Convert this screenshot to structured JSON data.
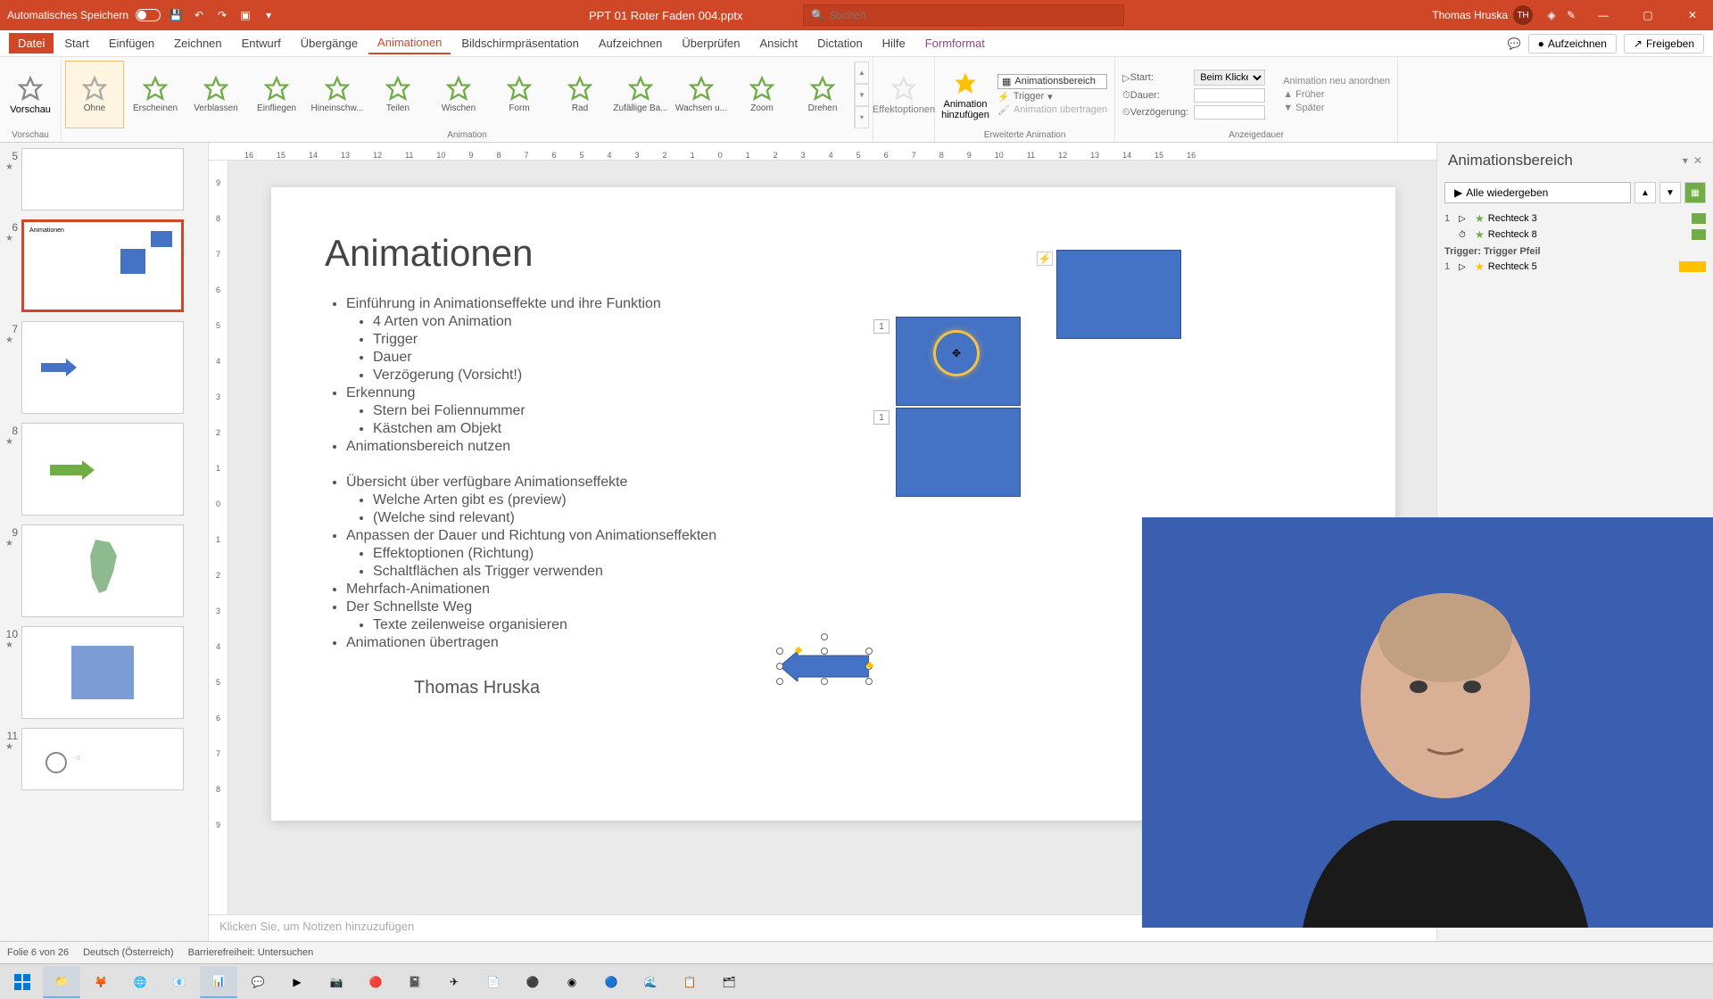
{
  "titlebar": {
    "autosave": "Automatisches Speichern",
    "filename": "PPT 01 Roter Faden 004.pptx",
    "search_placeholder": "Suchen",
    "user_name": "Thomas Hruska",
    "user_initials": "TH"
  },
  "menu": {
    "tabs": [
      "Datei",
      "Start",
      "Einfügen",
      "Zeichnen",
      "Entwurf",
      "Übergänge",
      "Animationen",
      "Bildschirmpräsentation",
      "Aufzeichnen",
      "Überprüfen",
      "Ansicht",
      "Dictation",
      "Hilfe",
      "Formformat"
    ],
    "active": "Animationen",
    "record": "Aufzeichnen",
    "share": "Freigeben"
  },
  "ribbon": {
    "preview": "Vorschau",
    "preview_group": "Vorschau",
    "gallery": [
      "Ohne",
      "Erscheinen",
      "Verblassen",
      "Einfliegen",
      "Hineinschw...",
      "Teilen",
      "Wischen",
      "Form",
      "Rad",
      "Zufällige Ba...",
      "Wachsen u...",
      "Zoom",
      "Drehen"
    ],
    "gallery_group": "Animation",
    "effect_options": "Effektoptionen",
    "add_anim": "Animation hinzufügen",
    "anims_pane": "Animationsbereich",
    "trigger": "Trigger",
    "copy_anim": "Animation übertragen",
    "adv_group": "Erweiterte Animation",
    "start_lbl": "Start:",
    "start_val": "Beim Klicken",
    "duration_lbl": "Dauer:",
    "delay_lbl": "Verzögerung:",
    "reorder": "Animation neu anordnen",
    "earlier": "Früher",
    "later": "Später",
    "timing_group": "Anzeigedauer"
  },
  "ruler_marks": [
    "16",
    "15",
    "14",
    "13",
    "12",
    "11",
    "10",
    "9",
    "8",
    "7",
    "6",
    "5",
    "4",
    "3",
    "2",
    "1",
    "0",
    "1",
    "2",
    "3",
    "4",
    "5",
    "6",
    "7",
    "8",
    "9",
    "10",
    "11",
    "12",
    "13",
    "14",
    "15",
    "16"
  ],
  "ruler_v": [
    "9",
    "8",
    "7",
    "6",
    "5",
    "4",
    "3",
    "2",
    "1",
    "0",
    "1",
    "2",
    "3",
    "4",
    "5",
    "6",
    "7",
    "8",
    "9"
  ],
  "slide": {
    "title": "Animationen",
    "lines": [
      "Einführung in Animationseffekte und ihre Funktion",
      "4 Arten von Animation",
      "Trigger",
      "Dauer",
      "Verzögerung (Vorsicht!)",
      "Erkennung",
      "Stern bei Foliennummer",
      "Kästchen am Objekt",
      "Animationsbereich nutzen",
      "Übersicht über verfügbare Animationseffekte",
      "Welche Arten gibt es (preview)",
      "(Welche sind relevant)",
      "Anpassen der Dauer und Richtung von Animationseffekten",
      "Effektoptionen (Richtung)",
      "Schaltflächen als Trigger verwenden",
      "Mehrfach-Animationen",
      "Der Schnellste Weg",
      "Texte zeilenweise organisieren",
      "Animationen übertragen"
    ],
    "author": "Thomas Hruska",
    "tag1": "1",
    "tag2": "1"
  },
  "thumbs": [
    {
      "num": "5",
      "star": "★"
    },
    {
      "num": "6",
      "star": "★"
    },
    {
      "num": "7",
      "star": "★"
    },
    {
      "num": "8",
      "star": "★"
    },
    {
      "num": "9",
      "star": "★"
    },
    {
      "num": "10",
      "star": "★"
    },
    {
      "num": "11",
      "star": "★"
    }
  ],
  "notes_placeholder": "Klicken Sie, um Notizen hinzuzufügen",
  "anim_pane": {
    "title": "Animationsbereich",
    "play_all": "Alle wiedergeben",
    "entries": [
      {
        "num": "1",
        "sym": "▷",
        "name": "Rechteck 3",
        "color": "#70ad47",
        "star": "g"
      },
      {
        "num": "",
        "sym": "⏱",
        "name": "Rechteck 8",
        "color": "#70ad47",
        "star": "g"
      }
    ],
    "trigger_label": "Trigger: Trigger Pfeil",
    "trigger_entries": [
      {
        "num": "1",
        "sym": "▷",
        "name": "Rechteck 5",
        "color": "#ffc000",
        "star": "y"
      }
    ]
  },
  "status": {
    "slide": "Folie 6 von 26",
    "lang": "Deutsch (Österreich)",
    "access": "Barrierefreiheit: Untersuchen"
  }
}
